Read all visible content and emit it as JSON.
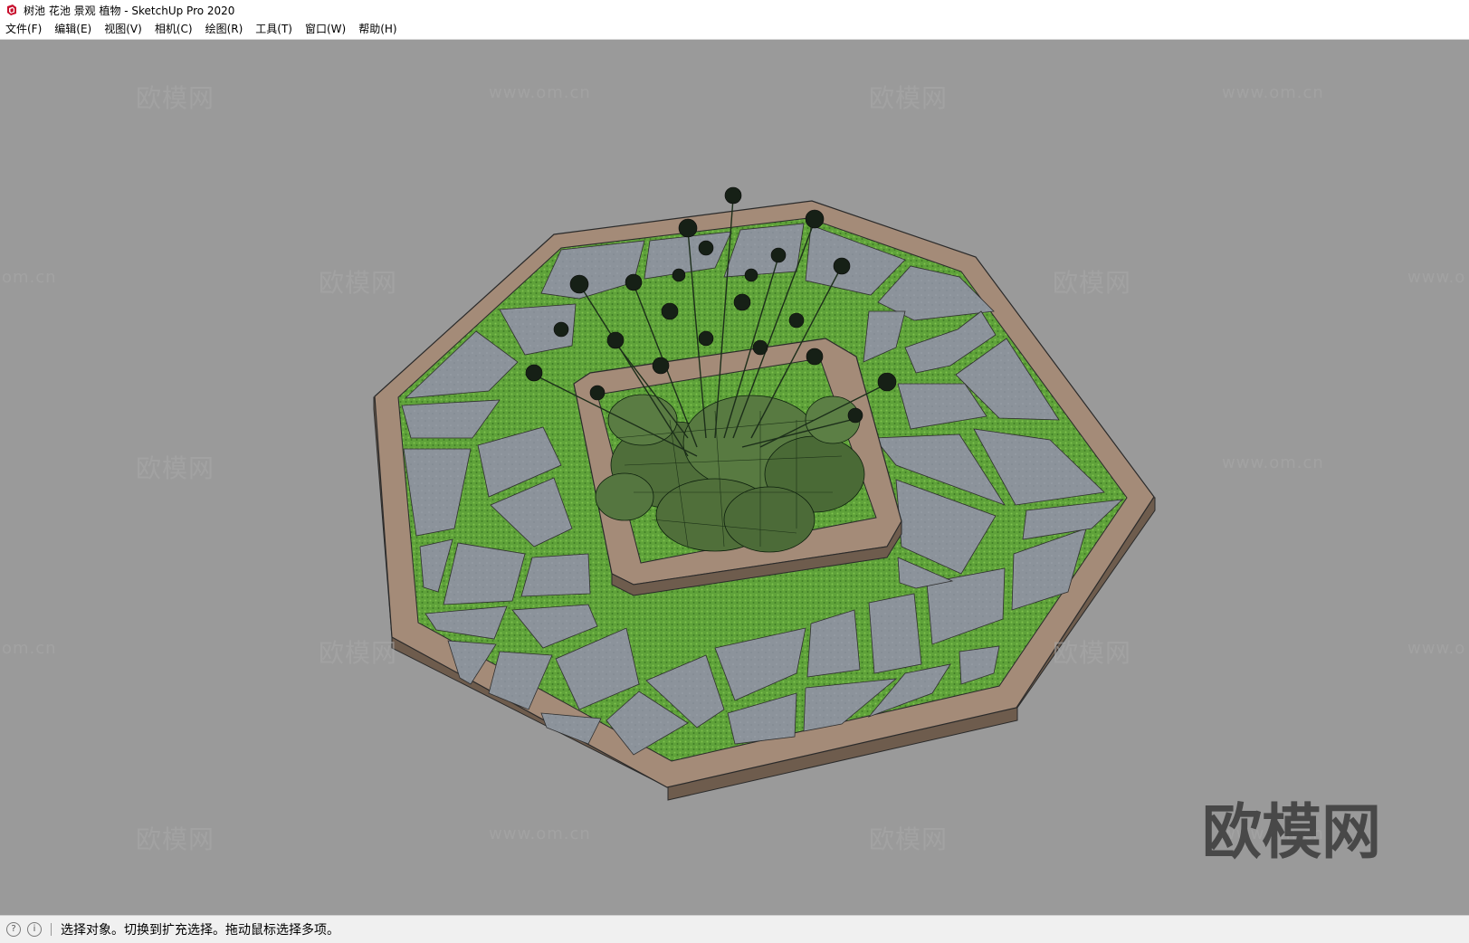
{
  "window": {
    "title": "树池 花池 景观 植物 - SketchUp Pro 2020",
    "icon": "sketchup-logo-icon",
    "accent": "#c8102e"
  },
  "menu": {
    "items": [
      {
        "label": "文件(F)"
      },
      {
        "label": "编辑(E)"
      },
      {
        "label": "视图(V)"
      },
      {
        "label": "相机(C)"
      },
      {
        "label": "绘图(R)"
      },
      {
        "label": "工具(T)"
      },
      {
        "label": "窗口(W)"
      },
      {
        "label": "帮助(H)"
      }
    ]
  },
  "viewport": {
    "background": "#9a9a9a",
    "model": "octagonal tree pool with flagstone paving, grass joints and a central flowering plant",
    "watermark": {
      "brand": "欧模网",
      "url": "www.om.cn",
      "url_partial": "om.cn",
      "url_partial_right": "www.o"
    }
  },
  "status": {
    "icon1": "geo-location-icon",
    "icon2": "credits-info-icon",
    "text": "选择对象。切换到扩充选择。拖动鼠标选择多项。"
  }
}
